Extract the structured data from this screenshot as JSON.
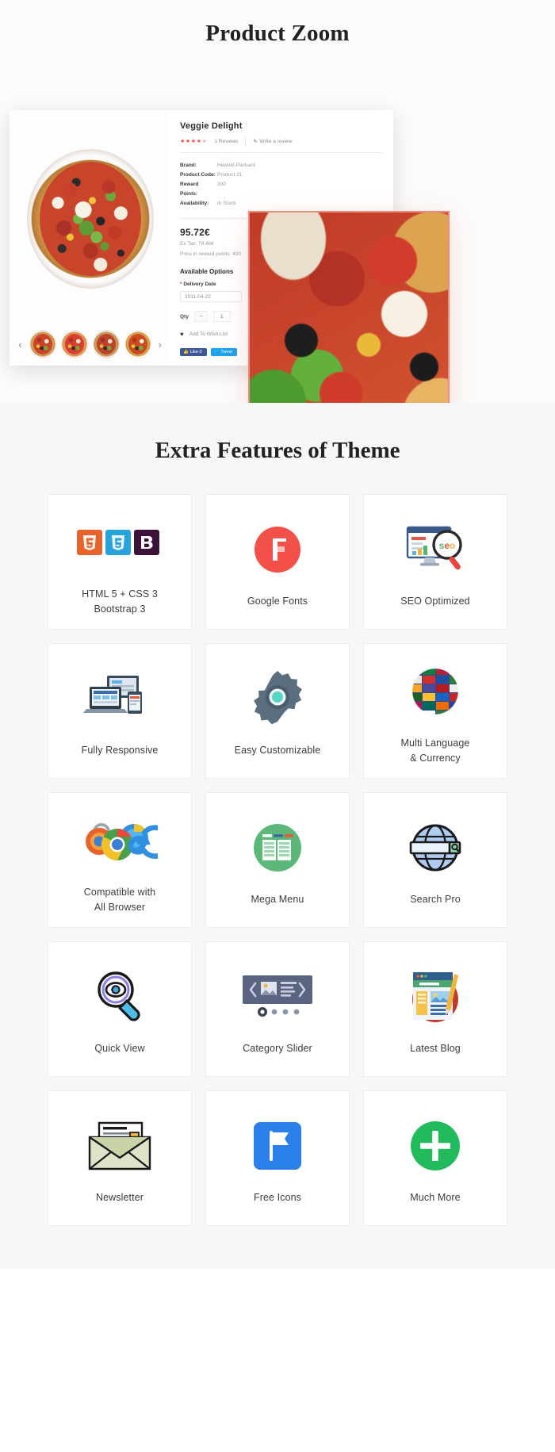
{
  "zoom_section": {
    "title": "Product Zoom",
    "product": {
      "name": "Veggie Delight",
      "rating_stars_filled": 4,
      "rating_stars_total": 5,
      "reviews_label": "1 Reviews",
      "write_review_label": "Write a review",
      "specs": [
        {
          "key": "Brand:",
          "value": "Hewlett-Packard"
        },
        {
          "key": "Product Code:",
          "value": "Product 21"
        },
        {
          "key": "Reward Points:",
          "value": "300"
        },
        {
          "key": "Availability:",
          "value": "In Stock"
        }
      ],
      "price": "95.72€",
      "ex_tax": "Ex Tax: 78.46€",
      "reward_note": "Price in reward points: 400",
      "options_title": "Available Options",
      "delivery_label": "Delivery Date",
      "delivery_required_mark": "*",
      "delivery_value": "2011-04-22",
      "qty_label": "Qty",
      "qty_minus": "−",
      "qty_value": "1",
      "wish_label": "Add To Wish List",
      "heart_icon": "♥",
      "facebook_label": "Like 0",
      "twitter_label": "Tweet",
      "thumb_prev": "‹",
      "thumb_next": "›"
    }
  },
  "features_section": {
    "title": "Extra Features of Theme",
    "cards": [
      {
        "icon": "html5-css3-bootstrap-icon",
        "label": "HTML 5 + CSS 3\nBootstrap 3"
      },
      {
        "icon": "google-fonts-icon",
        "label": "Google Fonts"
      },
      {
        "icon": "seo-optimized-icon",
        "label": "SEO Optimized"
      },
      {
        "icon": "fully-responsive-icon",
        "label": "Fully Responsive"
      },
      {
        "icon": "easy-customizable-icon",
        "label": "Easy Customizable"
      },
      {
        "icon": "multi-language-currency-icon",
        "label": "Multi Language\n& Currency"
      },
      {
        "icon": "compatible-browser-icon",
        "label": "Compatible with\nAll Browser"
      },
      {
        "icon": "mega-menu-icon",
        "label": "Mega Menu"
      },
      {
        "icon": "search-pro-icon",
        "label": "Search Pro"
      },
      {
        "icon": "quick-view-icon",
        "label": "Quick View"
      },
      {
        "icon": "category-slider-icon",
        "label": "Category Slider"
      },
      {
        "icon": "latest-blog-icon",
        "label": "Latest Blog"
      },
      {
        "icon": "newsletter-icon",
        "label": "Newsletter"
      },
      {
        "icon": "free-icons-icon",
        "label": "Free Icons"
      },
      {
        "icon": "much-more-icon",
        "label": "Much More"
      }
    ],
    "colors": {
      "html5": "#e8622c",
      "css3": "#29a3dc",
      "bootstrap": "#3b1239",
      "google_fonts": "#f4504a",
      "mega_menu": "#5cb878",
      "much_more": "#22bb5b",
      "free_icons": "#2a7fe8"
    }
  }
}
